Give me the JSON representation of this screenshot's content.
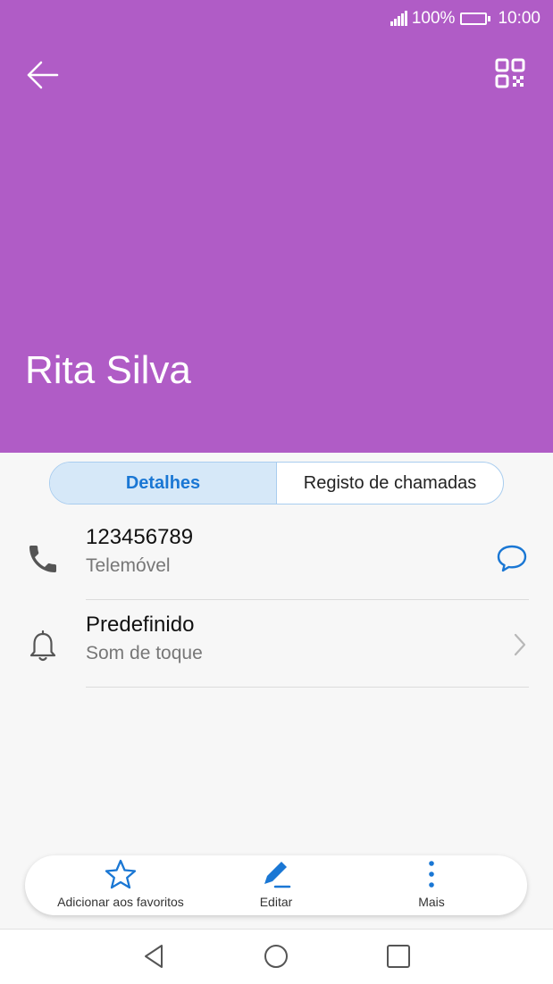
{
  "status_bar": {
    "battery": "100%",
    "time": "10:00"
  },
  "header": {
    "name": "Rita Silva",
    "background": "#b05cc6"
  },
  "tabs": [
    {
      "label": "Detalhes",
      "active": true
    },
    {
      "label": "Registo de chamadas",
      "active": false
    }
  ],
  "rows": [
    {
      "title": "123456789",
      "subtitle": "Telemóvel",
      "icon": "phone-icon",
      "action_icon": "message-icon"
    },
    {
      "title": "Predefinido",
      "subtitle": "Som de toque",
      "icon": "bell-icon",
      "action_icon": "chevron-right-icon"
    }
  ],
  "actions": [
    {
      "label": "Adicionar aos favoritos",
      "icon": "star-icon"
    },
    {
      "label": "Editar",
      "icon": "pencil-icon"
    },
    {
      "label": "Mais",
      "icon": "more-vertical-icon"
    }
  ],
  "colors": {
    "accent": "#1a77d4",
    "tab_active_bg": "#d6e8f8"
  }
}
